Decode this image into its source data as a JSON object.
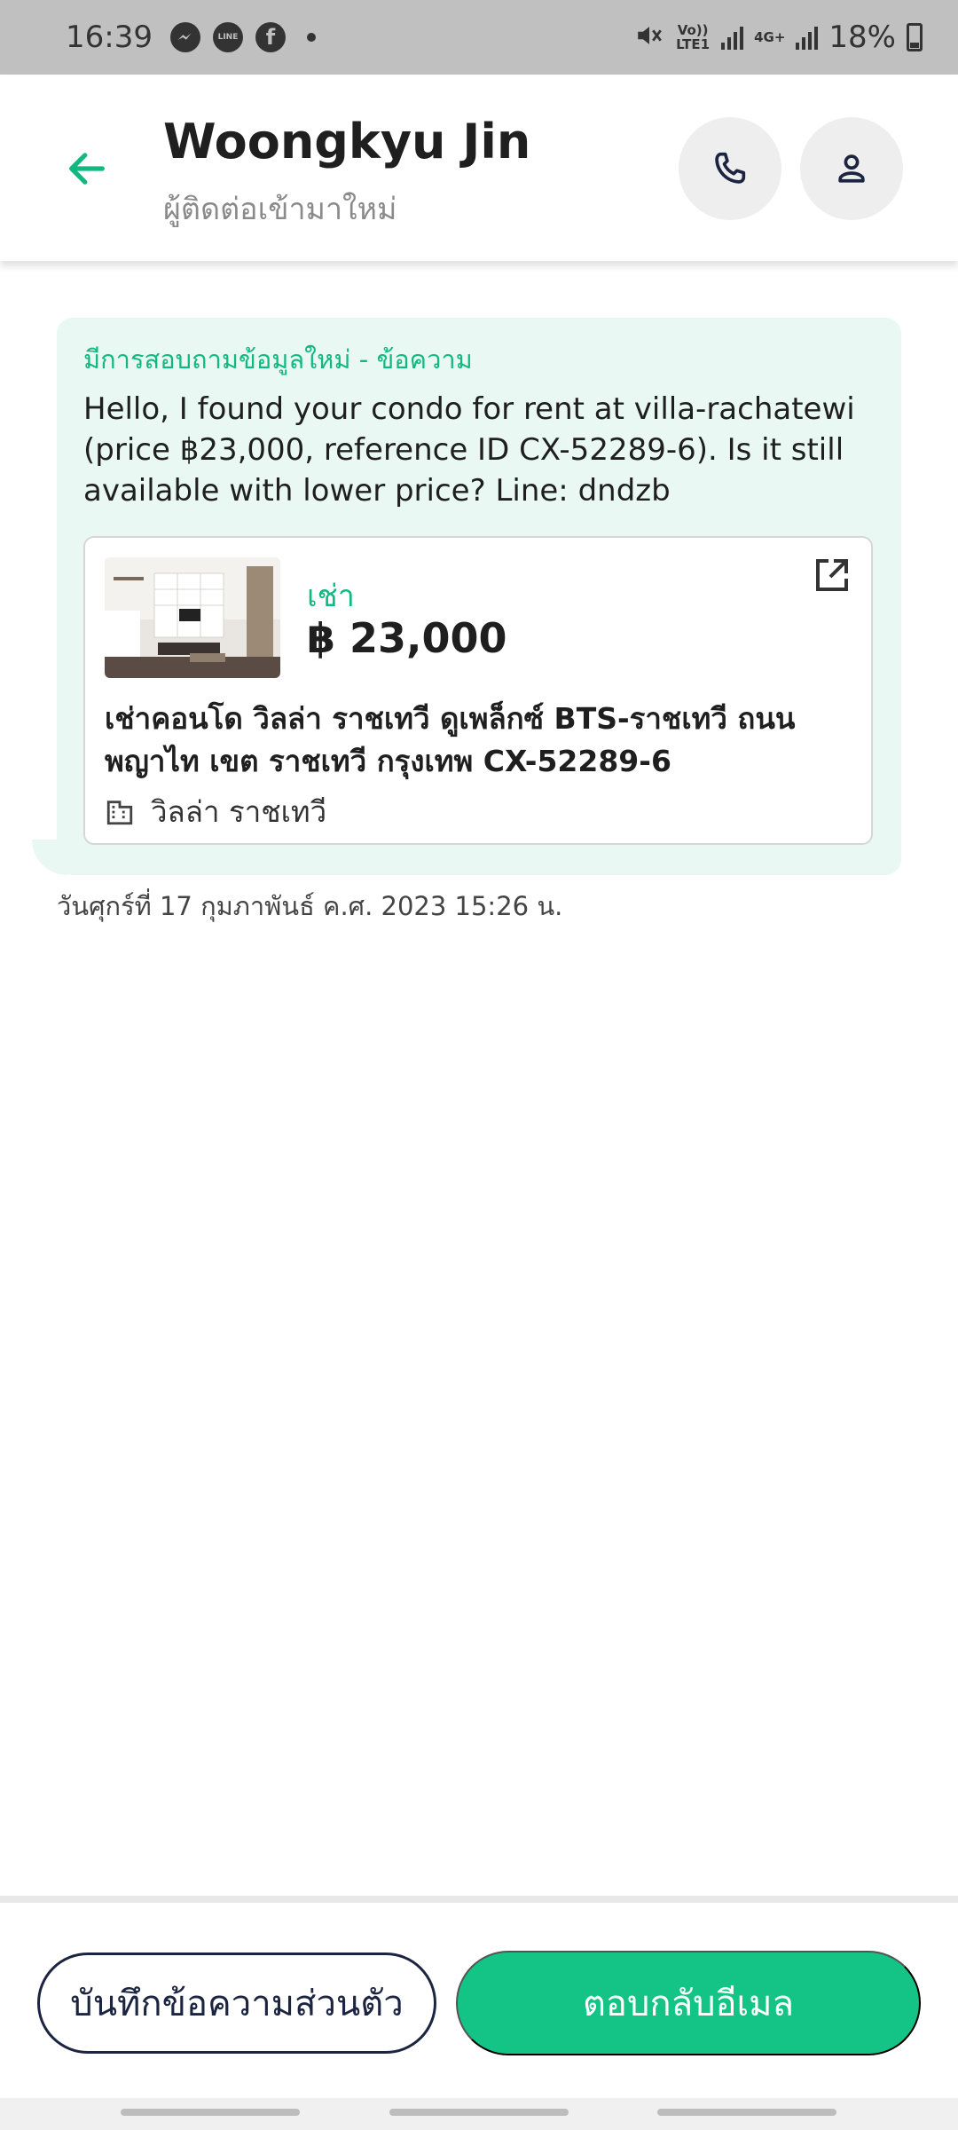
{
  "status_bar": {
    "time": "16:39",
    "apps": [
      "messenger-icon",
      "line-icon",
      "facebook-icon"
    ],
    "line_label": "LINE",
    "volte": "Vo)) LTE1",
    "network": "4G+",
    "battery": "18%",
    "battery_level": 0.18
  },
  "header": {
    "title": "Woongkyu Jin",
    "subtitle": "ผู้ติดต่อเข้ามาใหม่",
    "accent": "#11b981"
  },
  "message": {
    "heading": "มีการสอบถามข้อมูลใหม่ - ข้อความ",
    "body": "Hello, I found your condo for rent at villa-rachatewi (price ฿23,000, reference ID CX-52289-6). Is it still available with lower price? Line: dndzb",
    "timestamp": "วันศุกร์ที่ 17 กุมภาพันธ์ ค.ศ. 2023 15:26 น."
  },
  "listing": {
    "type": "เช่า",
    "price": "฿ 23,000",
    "title": "เช่าคอนโด  วิลล่า ราชเทวี ดูเพล็กซ์ BTS-ราชเทวี ถนนพญาไท เขต ราชเทวี กรุงเทพ CX-52289-6",
    "location": "วิลล่า ราชเทวี"
  },
  "actions": {
    "note_label": "บันทึกข้อความส่วนตัว",
    "reply_label": "ตอบกลับอีเมล",
    "reply_color": "#13c486",
    "note_border_color": "#1b2440"
  }
}
